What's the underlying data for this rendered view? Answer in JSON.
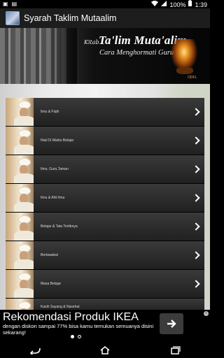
{
  "status_bar": {
    "battery": "100%",
    "time": "1:39"
  },
  "app": {
    "title": "Syarah Taklim Mutaalim"
  },
  "banner": {
    "kitab": "Kitab",
    "title": "Ta'lim Muta'alim",
    "subtitle": "Cara Menghormati Guru",
    "tag": "ODFL"
  },
  "list": {
    "items": [
      {
        "label": "Ilmu & Fiqih"
      },
      {
        "label": "Niat Di Waktu Belajar"
      },
      {
        "label": "Ilmu, Guru,Taman"
      },
      {
        "label": "Ilmu & Ahli Ilmu"
      },
      {
        "label": "Belajar & Tata Tertibnya"
      },
      {
        "label": "Bertawakal"
      },
      {
        "label": "Masa Belajar"
      },
      {
        "label": "Kasih Sayang & Nasehat"
      }
    ]
  },
  "ad": {
    "title": "Rekomendasi Produk IKEA",
    "description": "dengan diskon sampai 77% bisa kamu temukan semuanya disini sekarang!",
    "info": "i"
  },
  "colors": {
    "actionbar": "#1d1d1d",
    "row": "#2b2b2b",
    "status_bar": "#000000"
  }
}
